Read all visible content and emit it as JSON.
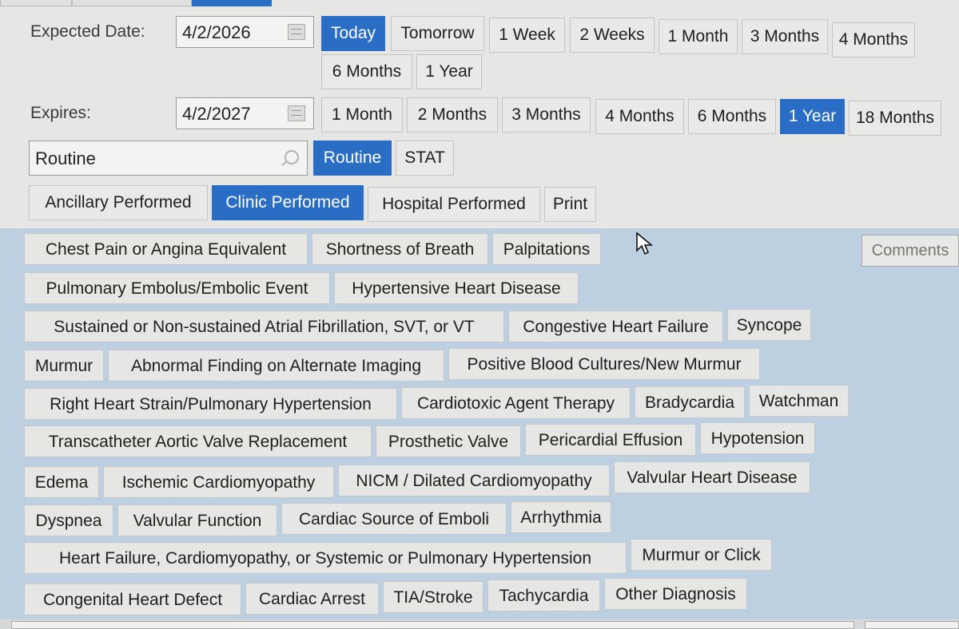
{
  "expected_date": {
    "label": "Expected Date:",
    "value": "4/2/2026",
    "options": [
      "Today",
      "Tomorrow",
      "1 Week",
      "2 Weeks",
      "1 Month",
      "3 Months",
      "4 Months",
      "6 Months",
      "1 Year"
    ],
    "selected": "Today"
  },
  "expires": {
    "label": "Expires:",
    "value": "4/2/2027",
    "options": [
      "1 Month",
      "2 Months",
      "3 Months",
      "4 Months",
      "6 Months",
      "1 Year",
      "18 Months"
    ],
    "selected": "1 Year"
  },
  "priority": {
    "value": "Routine",
    "options": [
      "Routine",
      "STAT"
    ],
    "selected": "Routine"
  },
  "performed": {
    "options": [
      "Ancillary Performed",
      "Clinic Performed",
      "Hospital Performed",
      "Print"
    ],
    "selected": "Clinic Performed"
  },
  "comments_label": "Comments",
  "diagnoses": [
    "Chest Pain or Angina Equivalent",
    "Shortness of Breath",
    "Palpitations",
    "Pulmonary Embolus/Embolic Event",
    "Hypertensive Heart Disease",
    "Sustained or Non-sustained Atrial Fibrillation, SVT, or VT",
    "Congestive Heart Failure",
    "Syncope",
    "Murmur",
    "Abnormal Finding on Alternate Imaging",
    "Positive Blood Cultures/New Murmur",
    "Right Heart Strain/Pulmonary Hypertension",
    "Cardiotoxic Agent Therapy",
    "Bradycardia",
    "Watchman",
    "Transcatheter Aortic Valve Replacement",
    "Prosthetic Valve",
    "Pericardial Effusion",
    "Hypotension",
    "Edema",
    "Ischemic Cardiomyopathy",
    "NICM / Dilated Cardiomyopathy",
    "Valvular Heart Disease",
    "Dyspnea",
    "Valvular Function",
    "Cardiac Source of Emboli",
    "Arrhythmia",
    "Heart Failure, Cardiomyopathy, or Systemic or Pulmonary Hypertension",
    "Murmur or Click",
    "Congenital Heart Defect",
    "Cardiac Arrest",
    "TIA/Stroke",
    "Tachycardia",
    "Other Diagnosis"
  ],
  "icons": {
    "calendar": "calendar-icon",
    "search": "search-icon",
    "cursor": "mouse-pointer-icon"
  }
}
